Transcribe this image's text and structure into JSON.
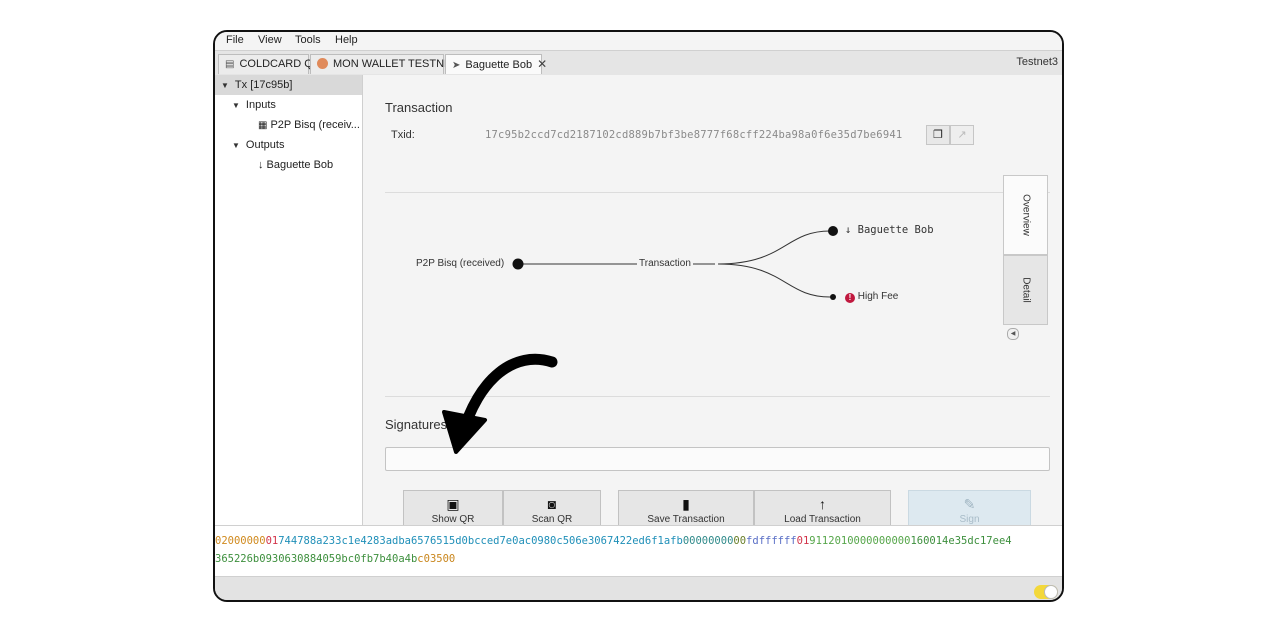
{
  "menu": [
    "File",
    "View",
    "Tools",
    "Help"
  ],
  "tabs": [
    {
      "label": "COLDCARD Q",
      "icon": "hardware-wallet-icon"
    },
    {
      "label": "MON WALLET TESTNET",
      "icon": "wallet-avatar-icon"
    },
    {
      "label": "Baguette Bob",
      "icon": "send-icon",
      "close": "✕"
    }
  ],
  "network": "Testnet3",
  "tree": {
    "root": "Tx [17c95b]",
    "inputs_label": "Inputs",
    "input_item": "P2P Bisq (receiv...",
    "outputs_label": "Outputs",
    "output_item": "Baguette Bob"
  },
  "transaction": {
    "title": "Transaction",
    "txid_label": "Txid:",
    "txid": "17c95b2ccd7cd2187102cd889b7bf3be8777f68cff224ba98a0f6e35d7be6941"
  },
  "diagram": {
    "input": "P2P Bisq (received)",
    "center": "Transaction",
    "output_recipient": "Baguette Bob",
    "output_fee": "High Fee"
  },
  "view_tabs": [
    "Overview",
    "Detail"
  ],
  "signatures": {
    "title": "Signatures"
  },
  "buttons": {
    "show_qr": "Show QR",
    "scan_qr": "Scan QR",
    "save": "Save Transaction",
    "load": "Load Transaction",
    "sign": "Sign"
  },
  "hex": {
    "line1": [
      {
        "text": "02000000",
        "color": "#d08a1e"
      },
      {
        "text": "01",
        "color": "#d2334a"
      },
      {
        "text": "744788a233c1e4283adba6576515d0bcced7e0ac0980c506e3067422ed6f1afb",
        "color": "#1f8fb8"
      },
      {
        "text": "00000000",
        "color": "#2f8a8a"
      },
      {
        "text": "00",
        "color": "#6a7f2a"
      },
      {
        "text": "fdffffff",
        "color": "#5a6fc6"
      },
      {
        "text": "01",
        "color": "#d2334a"
      },
      {
        "text": "9112010000000000",
        "color": "#56a64a"
      },
      {
        "text": "160014e35dc17ee4",
        "color": "#3d8f3d"
      }
    ],
    "line2": [
      {
        "text": "365226b0930630884059bc0fb7b40a4b",
        "color": "#3d8f3d"
      },
      {
        "text": "c03500",
        "color": "#c9861c"
      }
    ]
  },
  "colors": {
    "fee_warning": "#c0183e",
    "sign_disabled": "#dde9f0",
    "toggle": "#f3d83a"
  }
}
